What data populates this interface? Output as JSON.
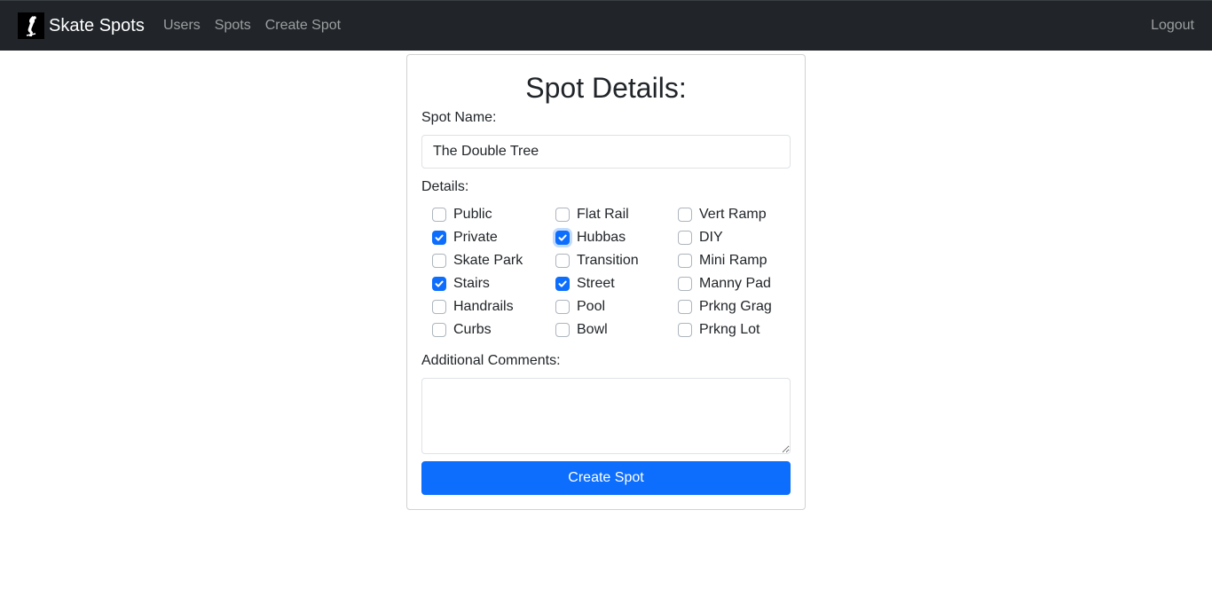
{
  "navbar": {
    "brand": "Skate Spots",
    "links": [
      "Users",
      "Spots",
      "Create Spot"
    ],
    "logout": "Logout"
  },
  "form": {
    "title": "Spot Details:",
    "spot_name_label": "Spot Name:",
    "spot_name_value": "The Double Tree",
    "details_label": "Details:",
    "details": [
      {
        "label": "Public",
        "checked": false
      },
      {
        "label": "Flat Rail",
        "checked": false
      },
      {
        "label": "Vert Ramp",
        "checked": false
      },
      {
        "label": "Private",
        "checked": true
      },
      {
        "label": "Hubbas",
        "checked": true,
        "focused": true
      },
      {
        "label": "DIY",
        "checked": false
      },
      {
        "label": "Skate Park",
        "checked": false
      },
      {
        "label": "Transition",
        "checked": false
      },
      {
        "label": "Mini Ramp",
        "checked": false
      },
      {
        "label": "Stairs",
        "checked": true
      },
      {
        "label": "Street",
        "checked": true
      },
      {
        "label": "Manny Pad",
        "checked": false
      },
      {
        "label": "Handrails",
        "checked": false
      },
      {
        "label": "Pool",
        "checked": false
      },
      {
        "label": "Prkng Grag",
        "checked": false
      },
      {
        "label": "Curbs",
        "checked": false
      },
      {
        "label": "Bowl",
        "checked": false
      },
      {
        "label": "Prkng Lot",
        "checked": false
      }
    ],
    "comments_label": "Additional Comments:",
    "comments_value": "",
    "submit_label": "Create Spot"
  },
  "colors": {
    "navbar_bg": "#212529",
    "primary": "#0d6efd"
  }
}
